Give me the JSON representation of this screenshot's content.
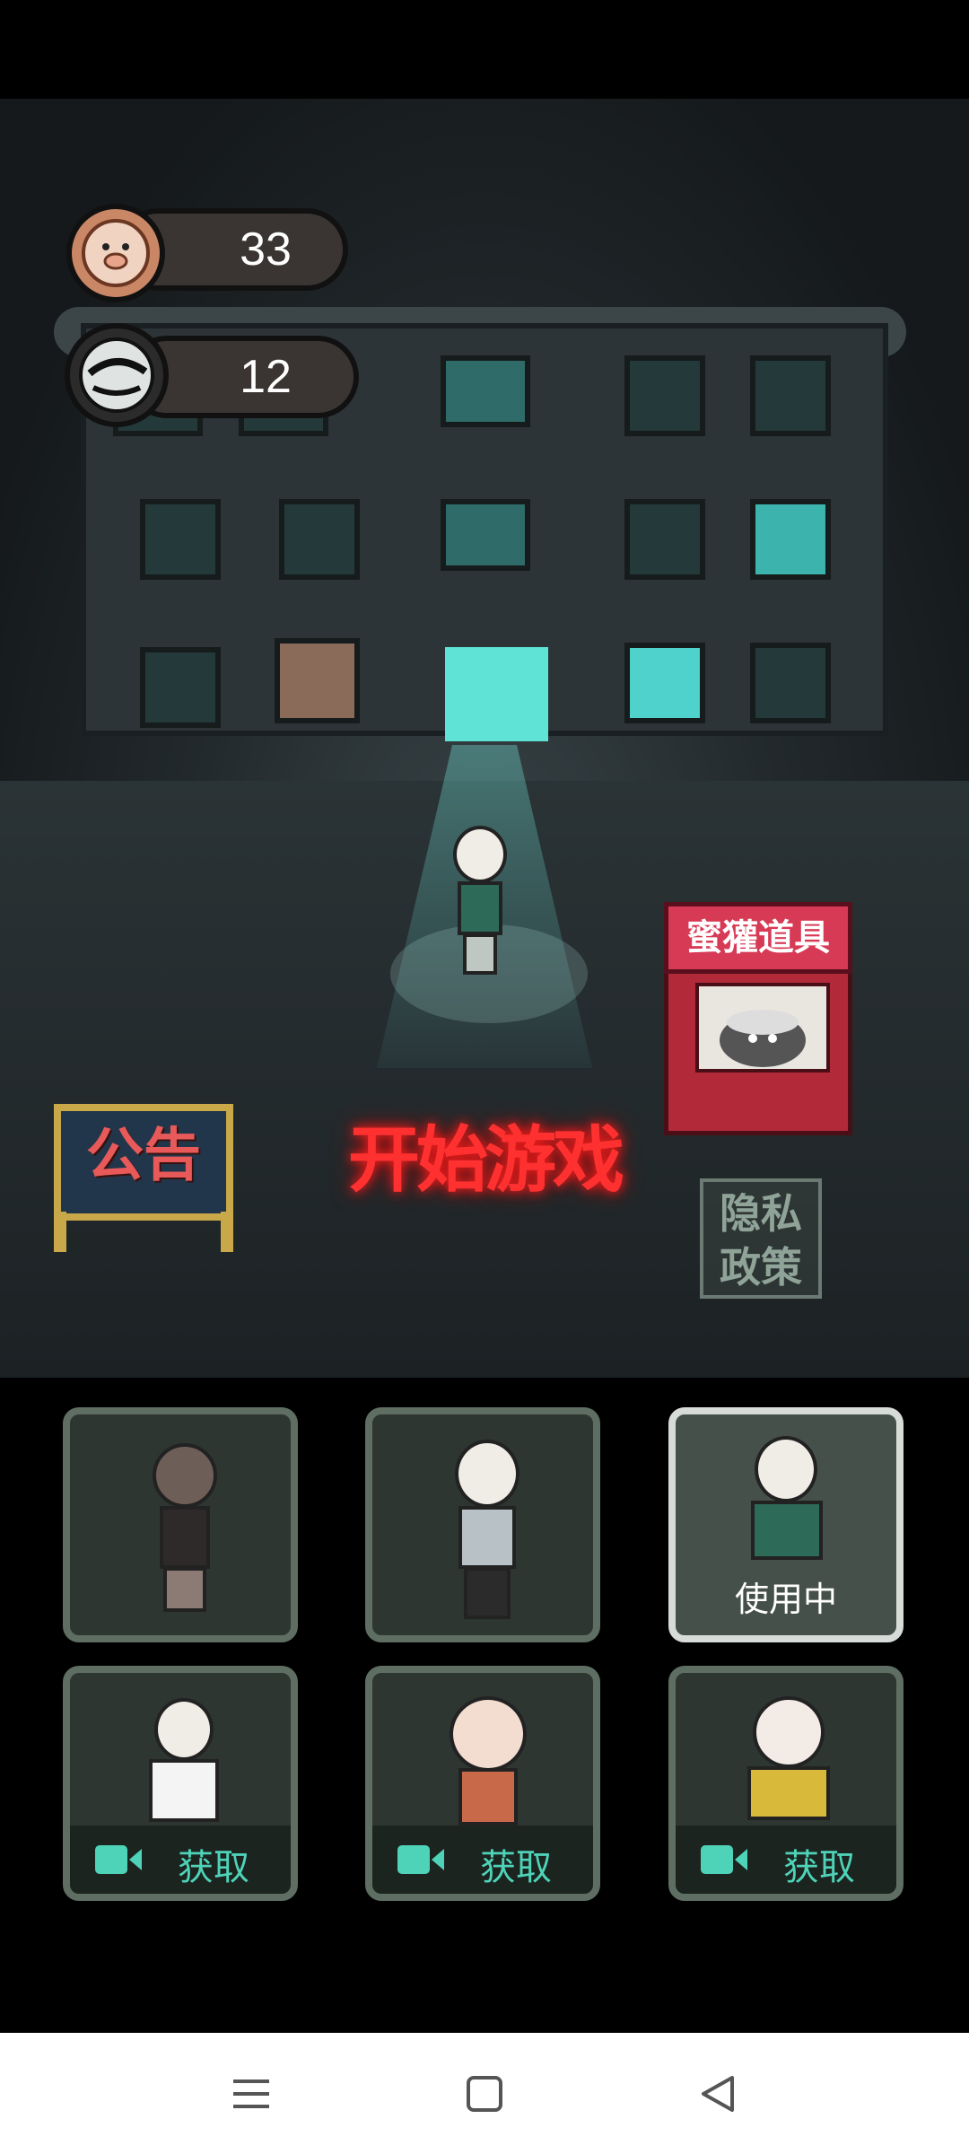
{
  "currency": {
    "coins": "33",
    "tickets": "12"
  },
  "scene": {
    "start_button": "开始游戏",
    "notice_button": "公告",
    "privacy_button_line1": "隐私",
    "privacy_button_line2": "政策",
    "shop_sign": "蜜獾道具"
  },
  "characters": [
    {
      "status": ""
    },
    {
      "status": ""
    },
    {
      "status": "使用中"
    },
    {
      "status": "获取"
    },
    {
      "status": "获取"
    },
    {
      "status": "获取"
    }
  ],
  "colors": {
    "start_glow": "#ff3030",
    "acquire_text": "#4fd3b8",
    "active_card_border": "#d8dcd9"
  },
  "icons": [
    "pig-coin-icon",
    "ticket-icon",
    "video-camera-icon",
    "menu-icon",
    "home-square-icon",
    "back-triangle-icon"
  ]
}
